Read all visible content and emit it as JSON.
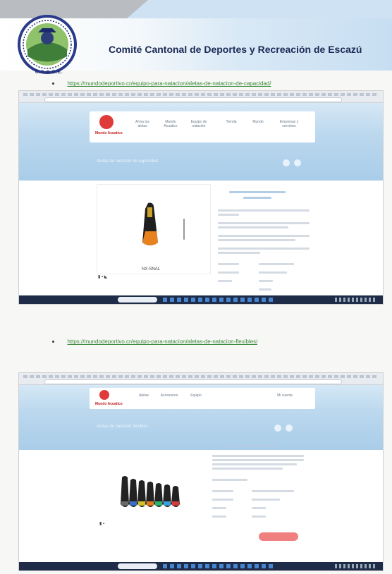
{
  "header": {
    "org_title": "Comité Cantonal de Deportes y Recreación de Escazú",
    "logo_caption": "C.C.D.R.E."
  },
  "links": [
    "https://mundodeportivo.cr/equipo-para-natacion/aletas-de-natacion-de-capacidad/",
    "https://mundodeportivo.cr/equipo-para-natacion/aletas-de-natacion-flexibles/"
  ],
  "screenshot1": {
    "brand": "Mundo Acuatico",
    "nav_items": [
      "Arma tus aletas",
      "Mundo Acuatico",
      "Equipo de natación",
      "Tienda",
      "Mundo",
      "Empresas y servicios"
    ],
    "hero_title": "Aletas de natación de capacidad",
    "sku": "NX-SNAL"
  },
  "screenshot2": {
    "brand": "Mundo Acuatico",
    "nav_items": [
      "Aletas",
      "Accesorios",
      "Equipo",
      "Mi cuenta"
    ],
    "hero_title": "Aletas de natación flexibles"
  },
  "colors": {
    "title": "#1b2a55",
    "link": "#3a8a3a",
    "hero": "#bcd8ee",
    "taskbar": "#1e2c48"
  }
}
